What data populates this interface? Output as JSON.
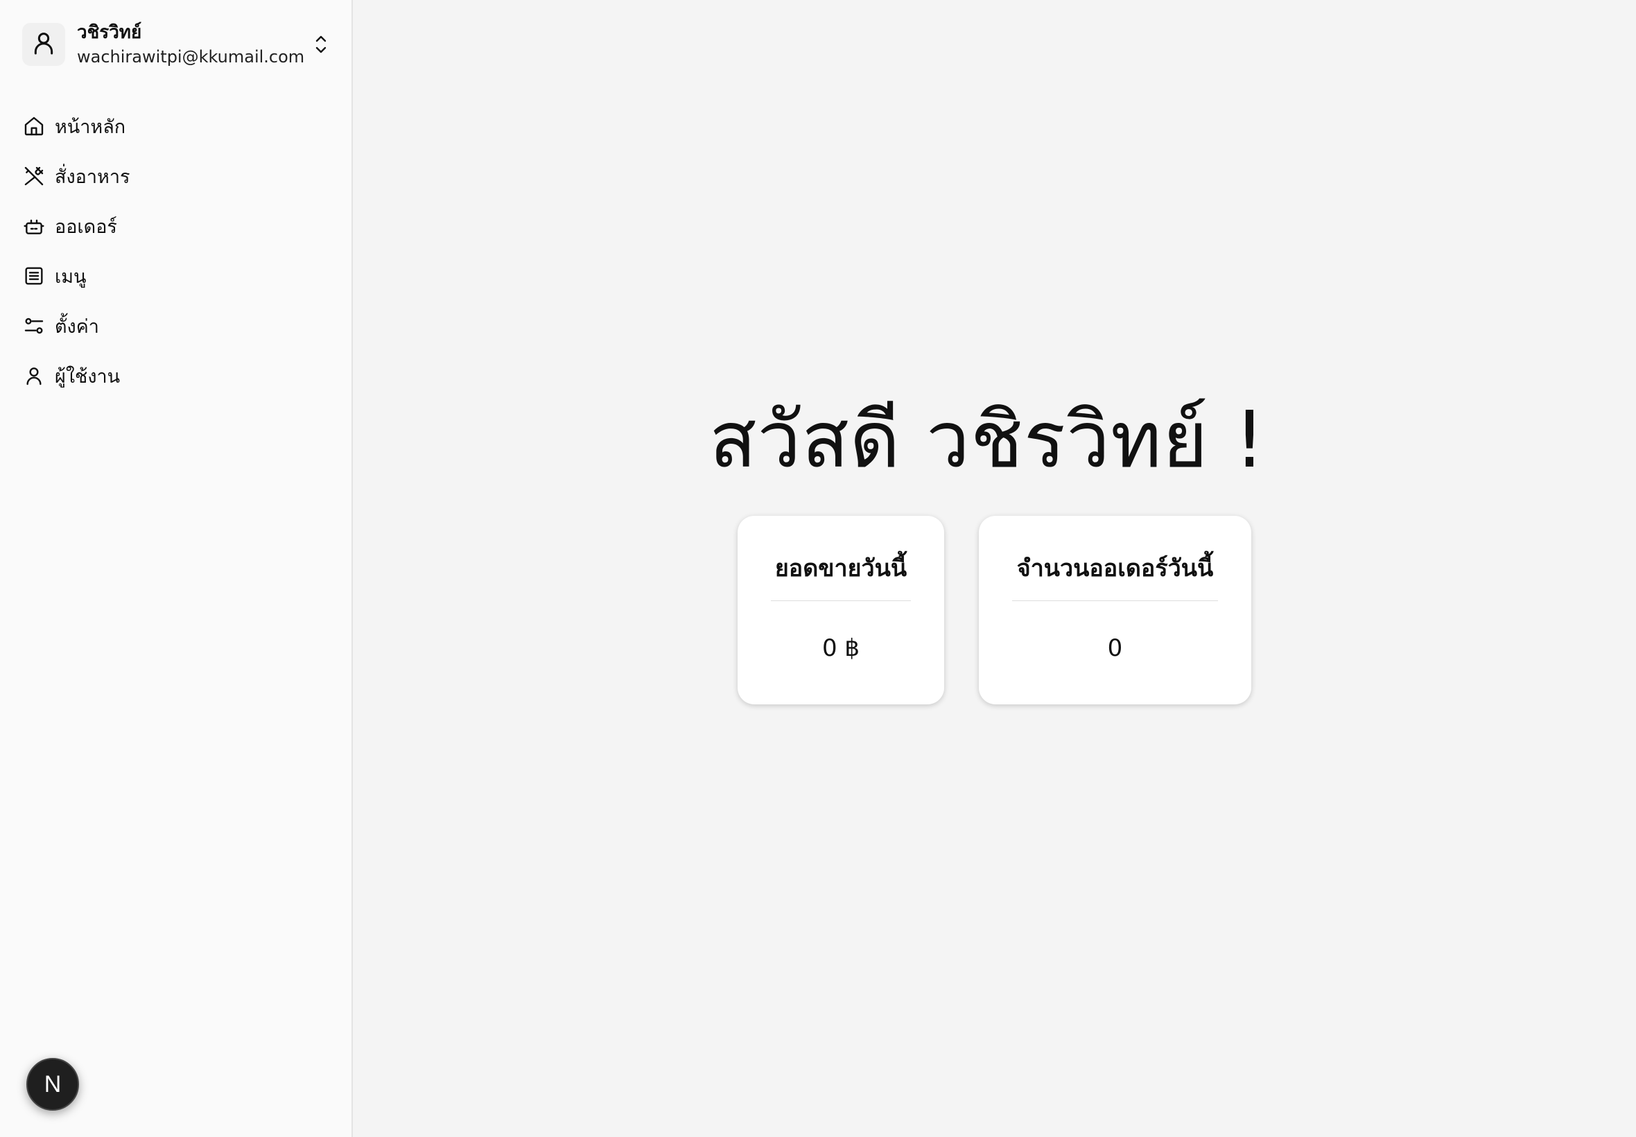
{
  "user": {
    "name": "วชิรวิทย์",
    "email": "wachirawitpi@kkumail.com"
  },
  "nav": {
    "items": [
      {
        "label": "หน้าหลัก",
        "icon": "home-icon"
      },
      {
        "label": "สั่งอาหาร",
        "icon": "utensils-crossed-icon"
      },
      {
        "label": "ออเดอร์",
        "icon": "cooking-pot-icon"
      },
      {
        "label": "เมนู",
        "icon": "list-icon"
      },
      {
        "label": "ตั้งค่า",
        "icon": "sliders-icon"
      },
      {
        "label": "ผู้ใช้งาน",
        "icon": "user-icon"
      }
    ]
  },
  "badge": {
    "letter": "N"
  },
  "main": {
    "greeting": "สวัสดี วชิรวิทย์ !",
    "cards": [
      {
        "title": "ยอดขายวันนี้",
        "value": "0 ฿"
      },
      {
        "title": "จำนวนออเดอร์วันนี้",
        "value": "0"
      }
    ]
  }
}
